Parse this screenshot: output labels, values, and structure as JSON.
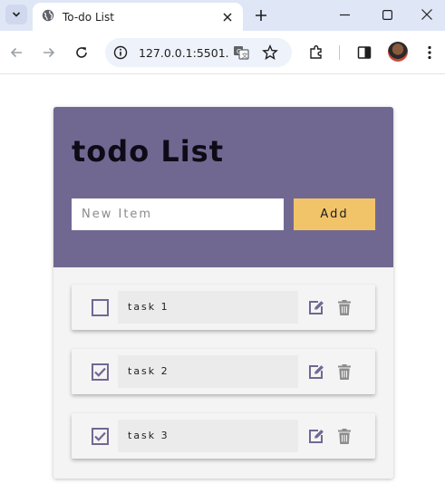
{
  "browser": {
    "tab_title": "To-do List",
    "url": "127.0.0.1:5501...",
    "icons": [
      "tab-search-icon",
      "globe-icon",
      "close-icon",
      "plus-icon",
      "minimize-icon",
      "maximize-icon",
      "close-window-icon",
      "back-arrow-icon",
      "forward-arrow-icon",
      "reload-icon",
      "site-info-icon",
      "translate-icon",
      "star-icon",
      "extensions-icon",
      "side-panel-icon",
      "avatar",
      "menu-icon"
    ]
  },
  "app": {
    "title": "todo List",
    "input_placeholder": "New Item",
    "input_value": "",
    "add_label": "Add",
    "colors": {
      "header": "#716892",
      "add_button": "#f2c46a",
      "card": "#f4f4f4",
      "accent": "#716892"
    },
    "tasks": [
      {
        "text": "task 1",
        "done": false
      },
      {
        "text": "task 2",
        "done": true
      },
      {
        "text": "task 3",
        "done": true
      }
    ]
  }
}
